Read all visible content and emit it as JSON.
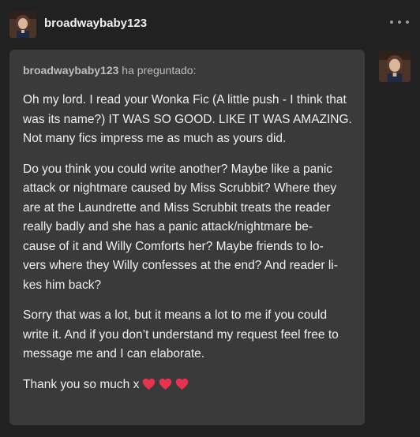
{
  "header": {
    "username": "broadwaybaby123",
    "avatar_icon": "user-avatar-icon",
    "menu_icon": "more-horizontal-icon"
  },
  "ask": {
    "asker": "broadwaybaby123",
    "asked_label": "ha preguntado:",
    "paragraphs": [
      "Oh my lord. I read your Wonka Fic (A little push - I think that was its name?) IT WAS SO GOOD. LIKE IT WAS AMAZING. Not many fics impress me as much as yours did.",
      "Do you think you could write another? Maybe like a panic attack or nightmare caused by Miss Scrubbit? Where they are at the Laundrette and Miss Scrubbit treats the reader really badly and she has a panic attack/nightmare be-\ncause of it and Willy Comforts her? Maybe friends to lo-\nvers where they Willy confesses at the end? And reader li-\nkes him back?",
      "Sorry that was a lot, but it means a lot to me if you could write it. And if you don’t understand my request feel free to message me and I can elaborate."
    ],
    "closing": "Thank you so much x",
    "hearts_count": 3,
    "heart_color": "#e8324f"
  },
  "colors": {
    "background": "#212121",
    "ask_box": "#3a3a3a",
    "text": "#eeeeee",
    "muted": "#bdbdbd"
  }
}
